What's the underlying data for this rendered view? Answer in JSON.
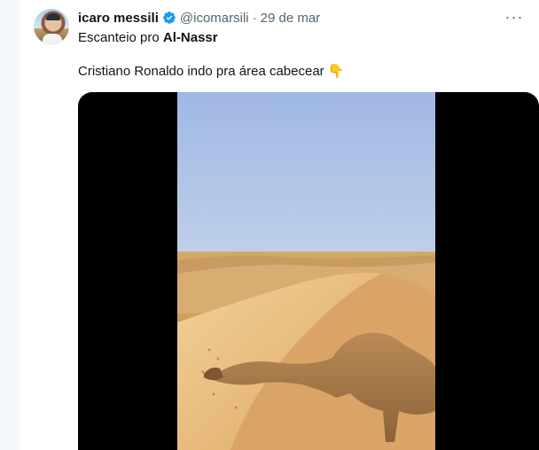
{
  "tweet": {
    "display_name": "icaro messili",
    "handle": "@icomarsili",
    "separator": "·",
    "date": "29 de mar",
    "more_label": "···",
    "reply_prefix": "Escanteio pro",
    "reply_target": "Al-Nassr",
    "text": "Cristiano Ronaldo indo pra área cabecear",
    "emoji": "👇"
  },
  "colors": {
    "verified": "#1d9bf0",
    "text_primary": "#0f1419",
    "text_secondary": "#536471"
  },
  "icons": {
    "verified": "verified-badge-icon",
    "more": "more-options-icon"
  }
}
